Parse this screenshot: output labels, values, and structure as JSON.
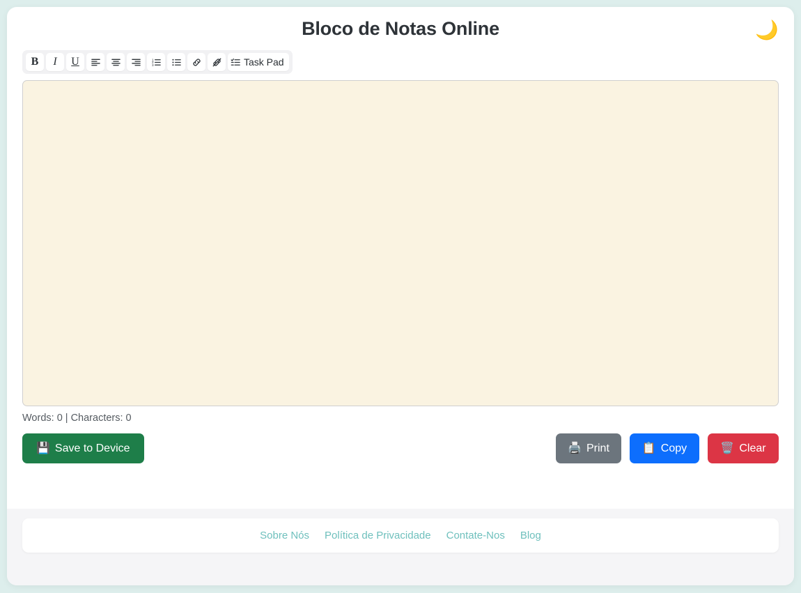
{
  "header": {
    "title": "Bloco de Notas Online",
    "theme_toggle_icon": "crescent-moon-icon",
    "theme_toggle_glyph": "🌙"
  },
  "toolbar": {
    "items": [
      {
        "name": "bold",
        "label": "B",
        "icon": "bold-icon"
      },
      {
        "name": "italic",
        "label": "I",
        "icon": "italic-icon"
      },
      {
        "name": "underline",
        "label": "U",
        "icon": "underline-icon"
      },
      {
        "name": "align-left",
        "label": "",
        "icon": "align-left-icon"
      },
      {
        "name": "align-center",
        "label": "",
        "icon": "align-center-icon"
      },
      {
        "name": "align-right",
        "label": "",
        "icon": "align-right-icon"
      },
      {
        "name": "ordered-list",
        "label": "",
        "icon": "ordered-list-icon"
      },
      {
        "name": "unordered-list",
        "label": "",
        "icon": "unordered-list-icon"
      },
      {
        "name": "insert-link",
        "label": "",
        "icon": "link-icon"
      },
      {
        "name": "remove-link",
        "label": "",
        "icon": "unlink-icon"
      },
      {
        "name": "task-pad",
        "label": "Task Pad",
        "icon": "task-list-icon"
      }
    ],
    "bold_label": "B",
    "italic_label": "I",
    "underline_label": "U",
    "task_pad_label": "Task Pad"
  },
  "editor": {
    "content": "",
    "placeholder": "",
    "background_color": "#faf3e1"
  },
  "counter": {
    "text": "Words: 0 | Characters: 0",
    "words": 0,
    "characters": 0
  },
  "actions": {
    "save": {
      "label": "Save to Device",
      "glyph": "💾",
      "icon": "floppy-disk-icon",
      "color": "#1e7e49"
    },
    "print": {
      "label": "Print",
      "glyph": "🖨️",
      "icon": "printer-icon",
      "color": "#6c757d"
    },
    "copy": {
      "label": "Copy",
      "glyph": "📋",
      "icon": "clipboard-icon",
      "color": "#0d6efd"
    },
    "clear": {
      "label": "Clear",
      "glyph": "🗑️",
      "icon": "trash-icon",
      "color": "#dc3545"
    }
  },
  "footer": {
    "links": [
      {
        "label": "Sobre Nós"
      },
      {
        "label": "Política de Privacidade"
      },
      {
        "label": "Contate-Nos"
      },
      {
        "label": "Blog"
      }
    ],
    "link_color": "#6fc0bd"
  },
  "theme": {
    "page_background": "#ddeeec",
    "card_background": "#ffffff",
    "footer_background": "#f5f5f7"
  }
}
